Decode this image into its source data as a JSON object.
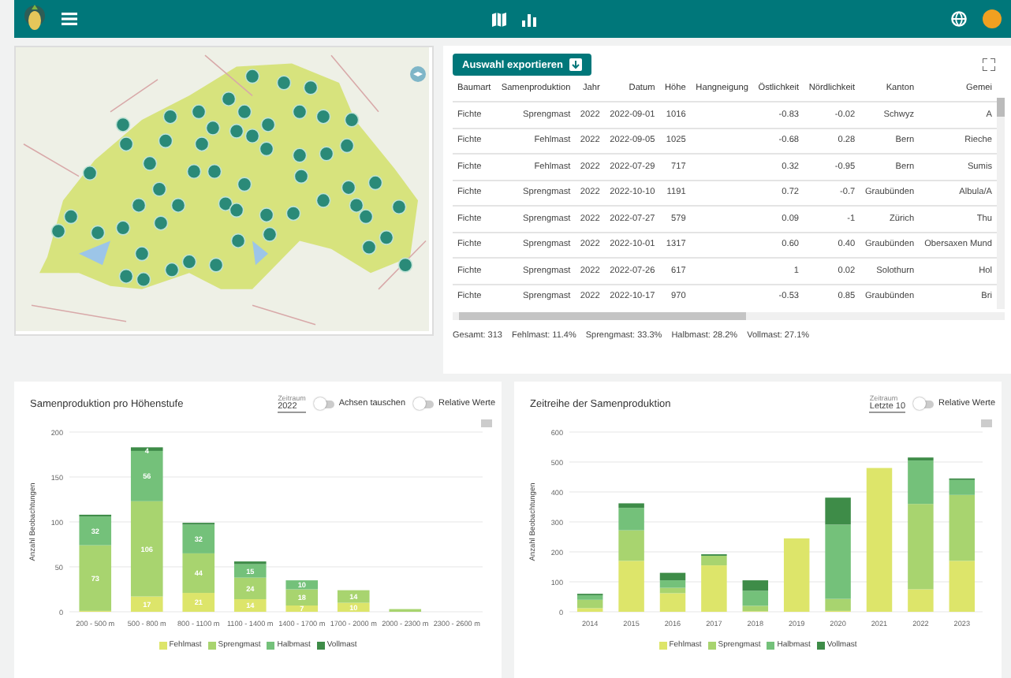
{
  "table": {
    "export_button": "Auswahl exportieren",
    "columns": [
      "Baumart",
      "Samenproduktion",
      "Jahr",
      "Datum",
      "Höhe",
      "Hangneigung",
      "Östlichkeit",
      "Nördlichkeit",
      "Kanton",
      "Gemei"
    ],
    "rows": [
      [
        "Fichte",
        "Sprengmast",
        "2022",
        "2022-09-01",
        "1016",
        "",
        "-0.83",
        "-0.02",
        "Schwyz",
        "A"
      ],
      [
        "Fichte",
        "Fehlmast",
        "2022",
        "2022-09-05",
        "1025",
        "",
        "-0.68",
        "0.28",
        "Bern",
        "Rieche"
      ],
      [
        "Fichte",
        "Fehlmast",
        "2022",
        "2022-07-29",
        "717",
        "",
        "0.32",
        "-0.95",
        "Bern",
        "Sumis"
      ],
      [
        "Fichte",
        "Sprengmast",
        "2022",
        "2022-10-10",
        "1191",
        "",
        "0.72",
        "-0.7",
        "Graubünden",
        "Albula/A"
      ],
      [
        "Fichte",
        "Sprengmast",
        "2022",
        "2022-07-27",
        "579",
        "",
        "0.09",
        "-1",
        "Zürich",
        "Thu"
      ],
      [
        "Fichte",
        "Sprengmast",
        "2022",
        "2022-10-01",
        "1317",
        "",
        "0.60",
        "0.40",
        "Graubünden",
        "Obersaxen Mund"
      ],
      [
        "Fichte",
        "Sprengmast",
        "2022",
        "2022-07-26",
        "617",
        "",
        "1",
        "0.02",
        "Solothurn",
        "Hol"
      ],
      [
        "Fichte",
        "Sprengmast",
        "2022",
        "2022-10-17",
        "970",
        "",
        "-0.53",
        "0.85",
        "Graubünden",
        "Bri"
      ]
    ],
    "summary": [
      "Gesamt: 313",
      "Fehlmast: 11.4%",
      "Sprengmast: 33.3%",
      "Halbmast: 28.2%",
      "Vollmast: 27.1%"
    ]
  },
  "panels": [
    {
      "title": "Samenproduktion pro Höhenstufe",
      "select_label": "Zeitraum",
      "select_value": "2022",
      "toggles": [
        {
          "label": "Achsen tauschen",
          "on": false
        },
        {
          "label": "Relative Werte",
          "on": false
        }
      ],
      "chart_data": {
        "type": "bar",
        "ylabel": "Anzahl Beobachtungen",
        "stacked": true,
        "grid": true,
        "ylim": [
          0,
          200
        ],
        "value_labels": [
          [
            null,
            "17",
            "21",
            "14",
            "7",
            "10",
            null,
            null
          ],
          [
            "73",
            "106",
            "44",
            "24",
            "18",
            "14",
            null,
            null
          ],
          [
            "32",
            "56",
            "32",
            "15",
            "10",
            null,
            null,
            null
          ],
          [
            null,
            "4",
            null,
            null,
            null,
            null,
            null,
            null
          ]
        ],
        "yticks": [
          0,
          50,
          100,
          150,
          200
        ],
        "categories": [
          "200 - 500 m",
          "500 - 800 m",
          "800 - 1100 m",
          "1100 - 1400 m",
          "1400 - 1700 m",
          "1700 - 2000 m",
          "2000 - 2300 m",
          "2300 - 2600 m"
        ],
        "series": [
          {
            "name": "Fehlmast",
            "color": "#dde56a",
            "values": [
              1,
              17,
              21,
              14,
              7,
              10,
              0,
              0
            ]
          },
          {
            "name": "Sprengmast",
            "color": "#a8d46f",
            "values": [
              73,
              106,
              44,
              24,
              18,
              14,
              3,
              0
            ]
          },
          {
            "name": "Halbmast",
            "color": "#74c17a",
            "values": [
              32,
              56,
              32,
              15,
              10,
              0,
              0,
              0
            ]
          },
          {
            "name": "Vollmast",
            "color": "#3e8c48",
            "values": [
              2,
              4,
              2,
              3,
              0,
              0,
              0,
              0
            ]
          }
        ]
      }
    },
    {
      "title": "Zeitreihe der Samenproduktion",
      "select_label": "Zeitraum",
      "select_value": "Letzte 10",
      "toggles": [
        {
          "label": "Relative Werte",
          "on": false
        }
      ],
      "chart_data": {
        "type": "bar",
        "ylabel": "Anzahl Beobachtungen",
        "stacked": true,
        "grid": true,
        "ylim": [
          0,
          600
        ],
        "yticks": [
          0,
          100,
          200,
          300,
          400,
          500,
          600
        ],
        "categories": [
          "2014",
          "2015",
          "2016",
          "2017",
          "2018",
          "2019",
          "2020",
          "2021",
          "2022",
          "2023"
        ],
        "series": [
          {
            "name": "Fehlmast",
            "color": "#dde56a",
            "values": [
              12,
              170,
              62,
              155,
              2,
              245,
              3,
              480,
              75,
              170
            ]
          },
          {
            "name": "Sprengmast",
            "color": "#a8d46f",
            "values": [
              28,
              102,
              18,
              32,
              18,
              0,
              40,
              0,
              285,
              220
            ]
          },
          {
            "name": "Halbmast",
            "color": "#74c17a",
            "values": [
              15,
              75,
              25,
              0,
              50,
              0,
              248,
              0,
              145,
              50
            ]
          },
          {
            "name": "Vollmast",
            "color": "#3e8c48",
            "values": [
              5,
              15,
              25,
              5,
              35,
              0,
              90,
              0,
              10,
              5
            ]
          }
        ]
      }
    }
  ]
}
